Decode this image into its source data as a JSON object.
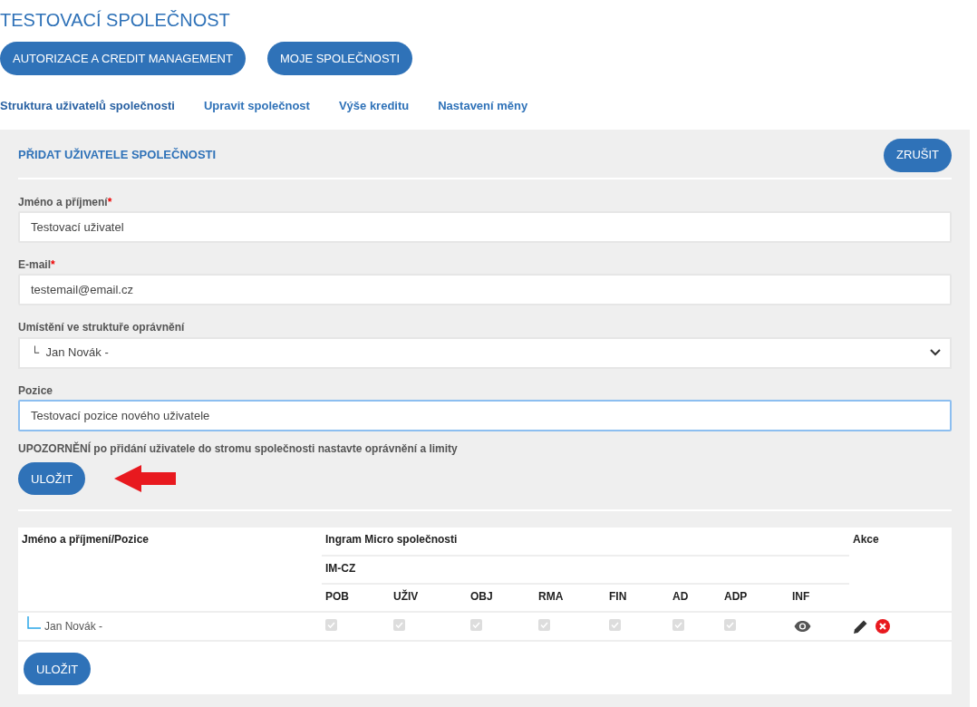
{
  "page_title": "TESTOVACÍ SPOLEČNOST",
  "top_buttons": [
    "AUTORIZACE A CREDIT MANAGEMENT",
    "MOJE SPOLEČNOSTI"
  ],
  "tabs": [
    {
      "label": "Struktura uživatelů společnosti",
      "selected": true
    },
    {
      "label": "Upravit společnost",
      "selected": false
    },
    {
      "label": "Výše kreditu",
      "selected": false
    },
    {
      "label": "Nastavení měny",
      "selected": false
    }
  ],
  "form": {
    "title": "PŘIDAT UŽIVATELE SPOLEČNOSTI",
    "cancel_button": "ZRUŠIT",
    "fields": [
      {
        "kind": "text",
        "label": "Jméno a příjmení",
        "required_mark": "*",
        "value": "Testovací uživatel",
        "focused": false
      },
      {
        "kind": "text",
        "label": "E-mail",
        "required_mark": "*",
        "value": "testemail@email.cz",
        "focused": false
      },
      {
        "kind": "select",
        "label": "Umístění ve struktuře oprávnění",
        "value": "└  Jan Novák -",
        "focused": false
      },
      {
        "kind": "text",
        "label": "Pozice",
        "value": "Testovací pozice nového uživatele",
        "focused": true
      }
    ],
    "warning": "**UPOZORNĚNÍ** po přidání uživatele do stromu společnosti nastavte oprávnění a limity",
    "save_button": "ULOŽIT"
  },
  "table": {
    "name_header": "Jméno a příjmení/Pozice",
    "group_header": "Ingram Micro společnosti",
    "company_header": "IM-CZ",
    "actions_header": "Akce",
    "columns": [
      "POB",
      "UŽIV",
      "OBJ",
      "RMA",
      "FIN",
      "AD",
      "ADP",
      "INF"
    ],
    "rows": [
      {
        "name": "Jan Novák -",
        "permissions": [
          {
            "checked": true,
            "disabled": true
          },
          {
            "checked": true,
            "disabled": true
          },
          {
            "checked": true,
            "disabled": true
          },
          {
            "checked": true,
            "disabled": true
          },
          {
            "checked": true,
            "disabled": true
          },
          {
            "checked": true,
            "disabled": true
          },
          {
            "checked": true,
            "disabled": true
          }
        ]
      }
    ]
  },
  "bottom_save_button": "ULOŽIT"
}
